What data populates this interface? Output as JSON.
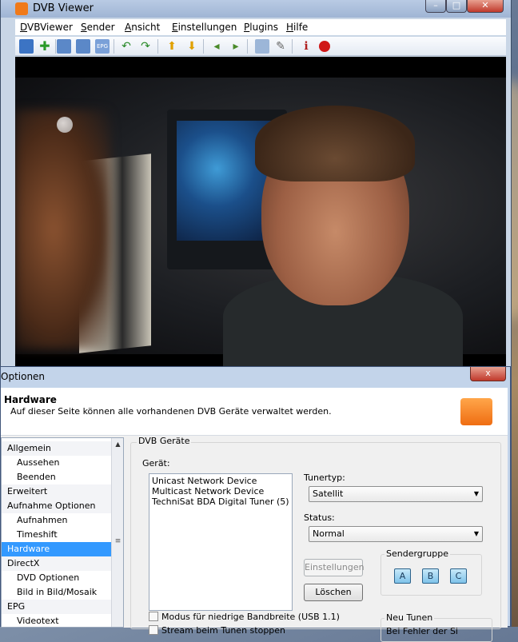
{
  "viewer": {
    "title": "DVB Viewer",
    "menu": [
      "DVBViewer",
      "Sender",
      "Ansicht",
      "Einstellungen",
      "Plugins",
      "Hilfe"
    ],
    "toolbar_labels": {
      "epg": "EPG"
    }
  },
  "options": {
    "title": "Optionen",
    "close_symbol": "x",
    "header": {
      "heading": "Hardware",
      "description": "Auf dieser Seite können alle vorhandenen DVB Geräte verwaltet werden."
    },
    "nav": [
      {
        "label": "Allgemein",
        "level": 0
      },
      {
        "label": "Aussehen",
        "level": 1
      },
      {
        "label": "Beenden",
        "level": 1
      },
      {
        "label": "Erweitert",
        "level": 0
      },
      {
        "label": "Aufnahme Optionen",
        "level": 0
      },
      {
        "label": "Aufnahmen",
        "level": 1
      },
      {
        "label": "Timeshift",
        "level": 1
      },
      {
        "label": "Hardware",
        "level": 0,
        "selected": true
      },
      {
        "label": "DirectX",
        "level": 0
      },
      {
        "label": "DVD Optionen",
        "level": 1
      },
      {
        "label": "Bild in Bild/Mosaik",
        "level": 1
      },
      {
        "label": "EPG",
        "level": 0
      },
      {
        "label": "Videotext",
        "level": 1
      }
    ],
    "group_title": "DVB Geräte",
    "device_label": "Gerät:",
    "devices": [
      "Unicast Network Device",
      "Multicast Network Device",
      "TechniSat BDA Digital Tuner (5)"
    ],
    "tunertyp_label": "Tunertyp:",
    "tunertyp_value": "Satellit",
    "status_label": "Status:",
    "status_value": "Normal",
    "einstellungen_button": "Einstellungen",
    "loeschen_button": "Löschen",
    "sendergruppe_label": "Sendergruppe",
    "sendergruppe_buttons": [
      "A",
      "B",
      "C"
    ],
    "checkbox_bandwidth": "Modus für niedrige Bandbreite (USB 1.1)",
    "checkbox_stream": "Stream beim Tunen stoppen",
    "neu_tunen_label": "Neu Tunen",
    "neu_tunen_text": "Bei Fehler der Si"
  }
}
